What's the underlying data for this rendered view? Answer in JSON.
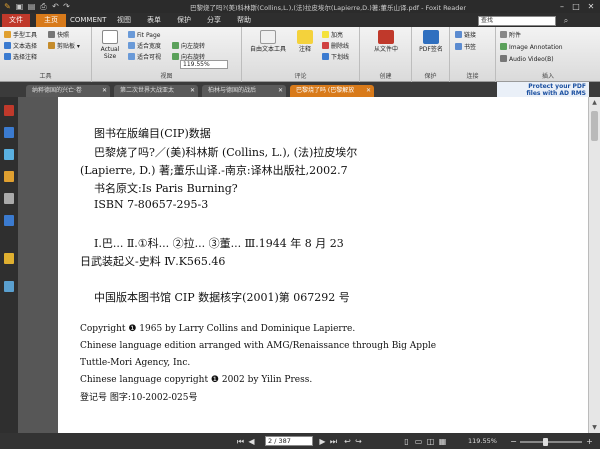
{
  "title_bar": {
    "title": "巴黎烧了吗?(美)科林斯(Collins,L.),(法)拉皮埃尔(Lapierre,D.)著;董乐山译.pdf - Foxit Reader"
  },
  "menu": {
    "tabs": [
      "文件",
      "主页",
      "COMMENT",
      "视图",
      "表单",
      "保护",
      "分享",
      "帮助"
    ],
    "active": "主页",
    "search_value": "查找"
  },
  "ribbon": {
    "tools": {
      "hand": "手型工具",
      "select_text": "文本选择",
      "select_annot": "选择注释",
      "snapshot": "快照",
      "clipboard": "剪贴板",
      "label": "工具"
    },
    "view": {
      "actual_size": "Actual Size",
      "fit_page": "Fit Page",
      "fit_width": "适合宽度",
      "fit_visible": "适合可视",
      "rotate_left": "向左旋转",
      "rotate_right": "向右旋转",
      "zoom": "119.55%",
      "label": "视图"
    },
    "comment": {
      "typewriter": "自由文本工具",
      "note": "注释",
      "highlight": "加亮",
      "strikeout": "删除线",
      "underline": "下划线",
      "label": "评论"
    },
    "create": {
      "from_file": "从文件中",
      "label": "创建"
    },
    "protect": {
      "pdf_sign": "PDF签名",
      "label": "保护"
    },
    "links": {
      "link": "链接",
      "bookmark": "书签",
      "label": "连接"
    },
    "insert": {
      "attachment": "附件",
      "image_annot": "Image Annotation",
      "audio_video": "Audio Video(B)",
      "label": "插入"
    }
  },
  "doc_tabs": [
    {
      "label": "纳粹德国的兴亡·卷",
      "active": false
    },
    {
      "label": "第二次世界大战亚太",
      "active": false
    },
    {
      "label": "柏林与德国的战后",
      "active": false
    },
    {
      "label": "巴黎烧了吗 (巴黎解放",
      "active": true
    }
  ],
  "ad": {
    "line1": "Protect your PDF",
    "line2": "files with AD RMS"
  },
  "page_content": {
    "lines": [
      "图书在版编目(CIP)数据",
      "巴黎烧了吗?／(美)科林斯 (Collins, L.), (法)拉皮埃尔",
      "(Lapierre, D.) 著;董乐山译.-南京:译林出版社,2002.7",
      "书名原文:Is Paris Burning?",
      "ISBN  7-80657-295-3",
      "Ⅰ.巴...   Ⅱ.①科...  ②拉...  ③董...    Ⅲ.1944 年 8 月 23",
      "日武装起义-史料   Ⅳ.K565.46",
      "中国版本图书馆 CIP 数据核字(2001)第 067292 号",
      "Copyright ❶ 1965 by Larry Collins and Dominique Lapierre.",
      "Chinese language edition arranged with AMG/Renaissance through Big Apple",
      "Tuttle-Mori Agency, Inc.",
      "Chinese language copyright ❶ 2002 by Yilin Press.",
      "登记号  图字:10-2002-025号"
    ]
  },
  "status": {
    "page": "2 / 387",
    "zoom": "119.55%",
    "zoom_level": 0.4
  }
}
